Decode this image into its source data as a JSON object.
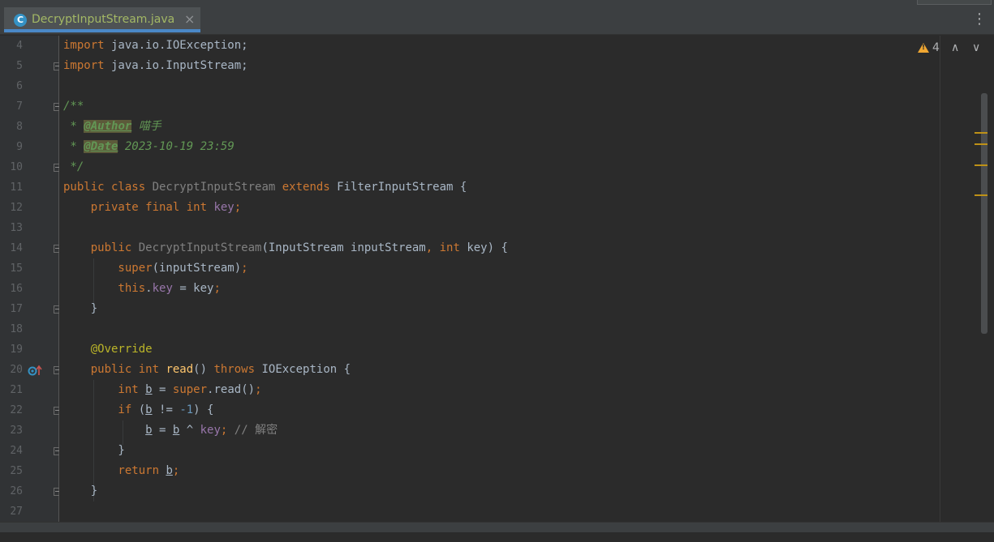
{
  "tab": {
    "icon_letter": "C",
    "title": "DecryptInputStream.java",
    "close": "×"
  },
  "toolbar": {
    "more": "⋮"
  },
  "inspections": {
    "warning_count": "4",
    "prev": "∧",
    "next": "∨"
  },
  "line_numbers": [
    "4",
    "5",
    "6",
    "7",
    "8",
    "9",
    "10",
    "11",
    "12",
    "13",
    "14",
    "15",
    "16",
    "17",
    "18",
    "19",
    "20",
    "21",
    "22",
    "23",
    "24",
    "25",
    "26",
    "27"
  ],
  "code": {
    "l4": [
      "import",
      " java.io.IOException;"
    ],
    "l5": [
      "import",
      " java.io.InputStream;"
    ],
    "l7": "/**",
    "l8": [
      " * ",
      "@Author",
      " 喵手"
    ],
    "l9": [
      " * ",
      "@Date",
      " 2023-10-19 23:59"
    ],
    "l10": " */",
    "l11": [
      "public class ",
      "DecryptInputStream",
      " extends ",
      "FilterInputStream {"
    ],
    "l12": [
      "    private final int ",
      "key",
      ";"
    ],
    "l14": [
      "    public ",
      "DecryptInputStream",
      "(InputStream inputStream",
      ", ",
      "int",
      " key) {"
    ],
    "l15": [
      "        super",
      "(inputStream)",
      ";"
    ],
    "l16": [
      "        this",
      ".",
      "key",
      " = key",
      ";"
    ],
    "l17": "    }",
    "l19": "    @Override",
    "l20": [
      "    public int ",
      "read",
      "() ",
      "throws",
      " IOException {"
    ],
    "l21": [
      "        int ",
      "b",
      " = ",
      "super",
      ".read()",
      ";"
    ],
    "l22": [
      "        if",
      " (",
      "b",
      " != ",
      "-1",
      ") {"
    ],
    "l23": [
      "            ",
      "b",
      " = ",
      "b",
      " ^ ",
      "key",
      "; ",
      "// 解密"
    ],
    "l24": "        }",
    "l25": [
      "        return ",
      "b",
      ";"
    ],
    "l26": "    }"
  },
  "colors": {
    "keyword": "#cc7832",
    "field": "#9876aa",
    "method": "#ffc66d",
    "annotation": "#bbb529",
    "number": "#6897bb",
    "comment": "#808080",
    "doc": "#629755",
    "default": "#a9b7c6",
    "tab_accent": "#4a88c7",
    "warning": "#f0a732"
  }
}
